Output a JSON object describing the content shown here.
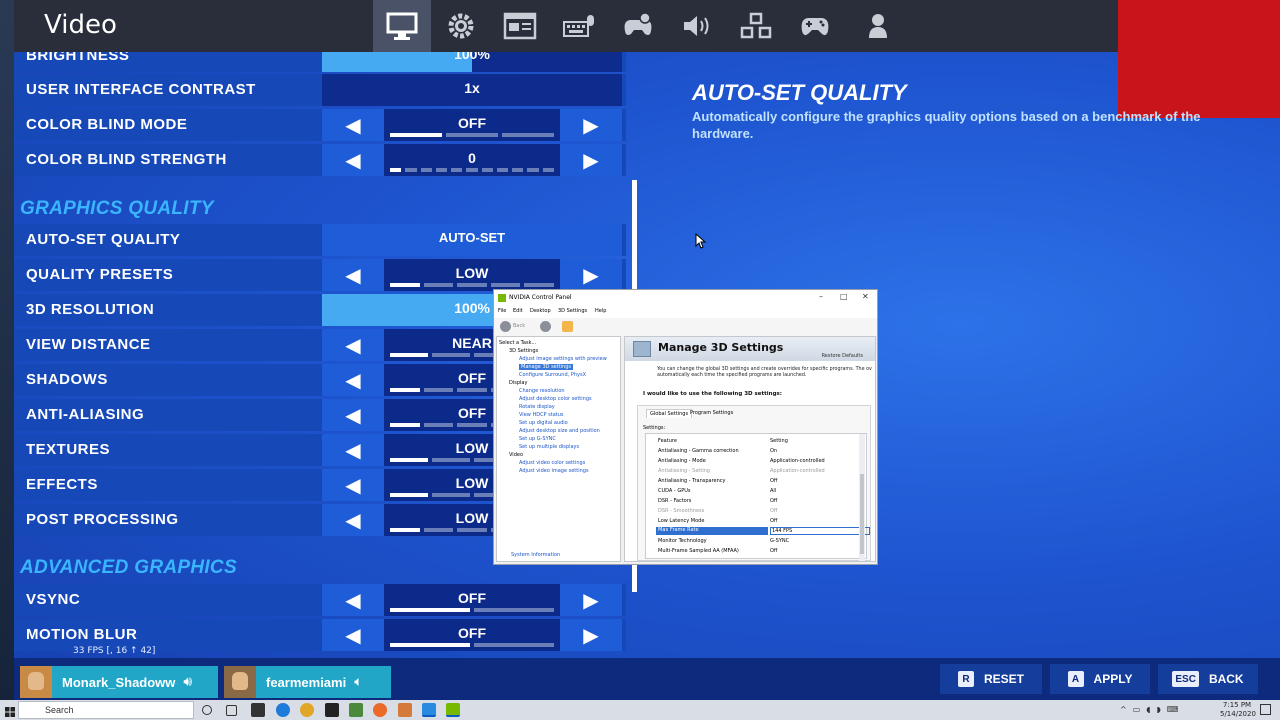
{
  "window_title": "Video",
  "nav_tabs": [
    {
      "icon": "monitor-icon",
      "active": true
    },
    {
      "icon": "gear-icon",
      "active": false
    },
    {
      "icon": "game-ui-icon",
      "active": false
    },
    {
      "icon": "keyboard-mouse-icon",
      "active": false
    },
    {
      "icon": "controller-gear-icon",
      "active": false
    },
    {
      "icon": "speaker-icon",
      "active": false
    },
    {
      "icon": "accessibility-icon",
      "active": false
    },
    {
      "icon": "controller-icon",
      "active": false
    },
    {
      "icon": "account-icon",
      "active": false
    }
  ],
  "settings": {
    "brightness": {
      "label": "BRIGHTNESS",
      "value": "100%",
      "level": 0.5
    },
    "ui_contrast": {
      "label": "USER INTERFACE CONTRAST",
      "value": "1x"
    },
    "color_blind_mode": {
      "label": "COLOR BLIND MODE",
      "value": "OFF"
    },
    "color_blind_strength": {
      "label": "COLOR BLIND STRENGTH",
      "value": "0"
    },
    "section_graphics": "GRAPHICS QUALITY",
    "auto_set_quality": {
      "label": "AUTO-SET QUALITY",
      "value": "AUTO-SET"
    },
    "quality_presets": {
      "label": "QUALITY PRESETS",
      "value": "LOW"
    },
    "resolution_3d": {
      "label": "3D RESOLUTION",
      "value": "100%",
      "level": 1.0
    },
    "view_distance": {
      "label": "VIEW DISTANCE",
      "value": "NEAR"
    },
    "shadows": {
      "label": "SHADOWS",
      "value": "OFF"
    },
    "anti_aliasing": {
      "label": "ANTI-ALIASING",
      "value": "OFF"
    },
    "textures": {
      "label": "TEXTURES",
      "value": "LOW"
    },
    "effects": {
      "label": "EFFECTS",
      "value": "LOW"
    },
    "post_processing": {
      "label": "POST PROCESSING",
      "value": "LOW"
    },
    "section_advanced": "ADVANCED GRAPHICS",
    "vsync": {
      "label": "VSYNC",
      "value": "OFF"
    },
    "motion_blur": {
      "label": "MOTION BLUR",
      "value": "OFF"
    }
  },
  "fps_readout": "33 FPS [, 16 ↑ 42]",
  "description": {
    "title": "AUTO-SET QUALITY",
    "text": "Automatically configure the graphics quality options based on a benchmark of the hardware."
  },
  "players": [
    {
      "name": "Monark_Shadoww",
      "speaker": "speaker-on-icon"
    },
    {
      "name": "fearmemiami",
      "speaker": "speaker-low-icon"
    }
  ],
  "buttons": {
    "reset": {
      "key": "R",
      "label": "RESET"
    },
    "apply": {
      "key": "A",
      "label": "APPLY"
    },
    "back": {
      "key": "ESC",
      "label": "BACK"
    }
  },
  "taskbar": {
    "search_placeholder": "Search",
    "time": "7:15 PM",
    "date": "5/14/2020"
  },
  "nvidia": {
    "title": "NVIDIA Control Panel",
    "menu": [
      "File",
      "Edit",
      "Desktop",
      "3D Settings",
      "Help"
    ],
    "back_label": "Back",
    "task_header": "Select a Task...",
    "tree": [
      {
        "text": "3D Settings",
        "kind": "group"
      },
      {
        "text": "Adjust image settings with preview",
        "kind": "link"
      },
      {
        "text": "Manage 3D settings",
        "kind": "selected"
      },
      {
        "text": "Configure Surround, PhysX",
        "kind": "link"
      },
      {
        "text": "Display",
        "kind": "group"
      },
      {
        "text": "Change resolution",
        "kind": "link"
      },
      {
        "text": "Adjust desktop color settings",
        "kind": "link"
      },
      {
        "text": "Rotate display",
        "kind": "link"
      },
      {
        "text": "View HDCP status",
        "kind": "link"
      },
      {
        "text": "Set up digital audio",
        "kind": "link"
      },
      {
        "text": "Adjust desktop size and position",
        "kind": "link"
      },
      {
        "text": "Set up G-SYNC",
        "kind": "link"
      },
      {
        "text": "Set up multiple displays",
        "kind": "link"
      },
      {
        "text": "Video",
        "kind": "group"
      },
      {
        "text": "Adjust video color settings",
        "kind": "link"
      },
      {
        "text": "Adjust video image settings",
        "kind": "link"
      }
    ],
    "system_info": "System Information",
    "heading": "Manage 3D Settings",
    "restore": "Restore Defaults",
    "intro": "You can change the global 3D settings and create overrides for specific programs. The ov automatically each time the specified programs are launched.",
    "prompt": "I would like to use the following 3D settings:",
    "tabs": [
      "Global Settings",
      "Program Settings"
    ],
    "settings_label": "Settings:",
    "columns": [
      "Feature",
      "Setting"
    ],
    "rows": [
      {
        "feature": "Antialiasing - Gamma correction",
        "setting": "On",
        "state": "normal"
      },
      {
        "feature": "Antialiasing - Mode",
        "setting": "Application-controlled",
        "state": "normal"
      },
      {
        "feature": "Antialiasing - Setting",
        "setting": "Application-controlled",
        "state": "dim"
      },
      {
        "feature": "Antialiasing - Transparency",
        "setting": "Off",
        "state": "normal"
      },
      {
        "feature": "CUDA - GPUs",
        "setting": "All",
        "state": "normal"
      },
      {
        "feature": "DSR - Factors",
        "setting": "Off",
        "state": "normal"
      },
      {
        "feature": "DSR - Smoothness",
        "setting": "Off",
        "state": "dim"
      },
      {
        "feature": "Low Latency Mode",
        "setting": "Off",
        "state": "normal"
      },
      {
        "feature": "Max Frame Rate",
        "setting": "144 FPS",
        "state": "highlight"
      },
      {
        "feature": "Monitor Technology",
        "setting": "G-SYNC",
        "state": "normal"
      },
      {
        "feature": "Multi-Frame Sampled AA (MFAA)",
        "setting": "Off",
        "state": "normal"
      }
    ]
  }
}
